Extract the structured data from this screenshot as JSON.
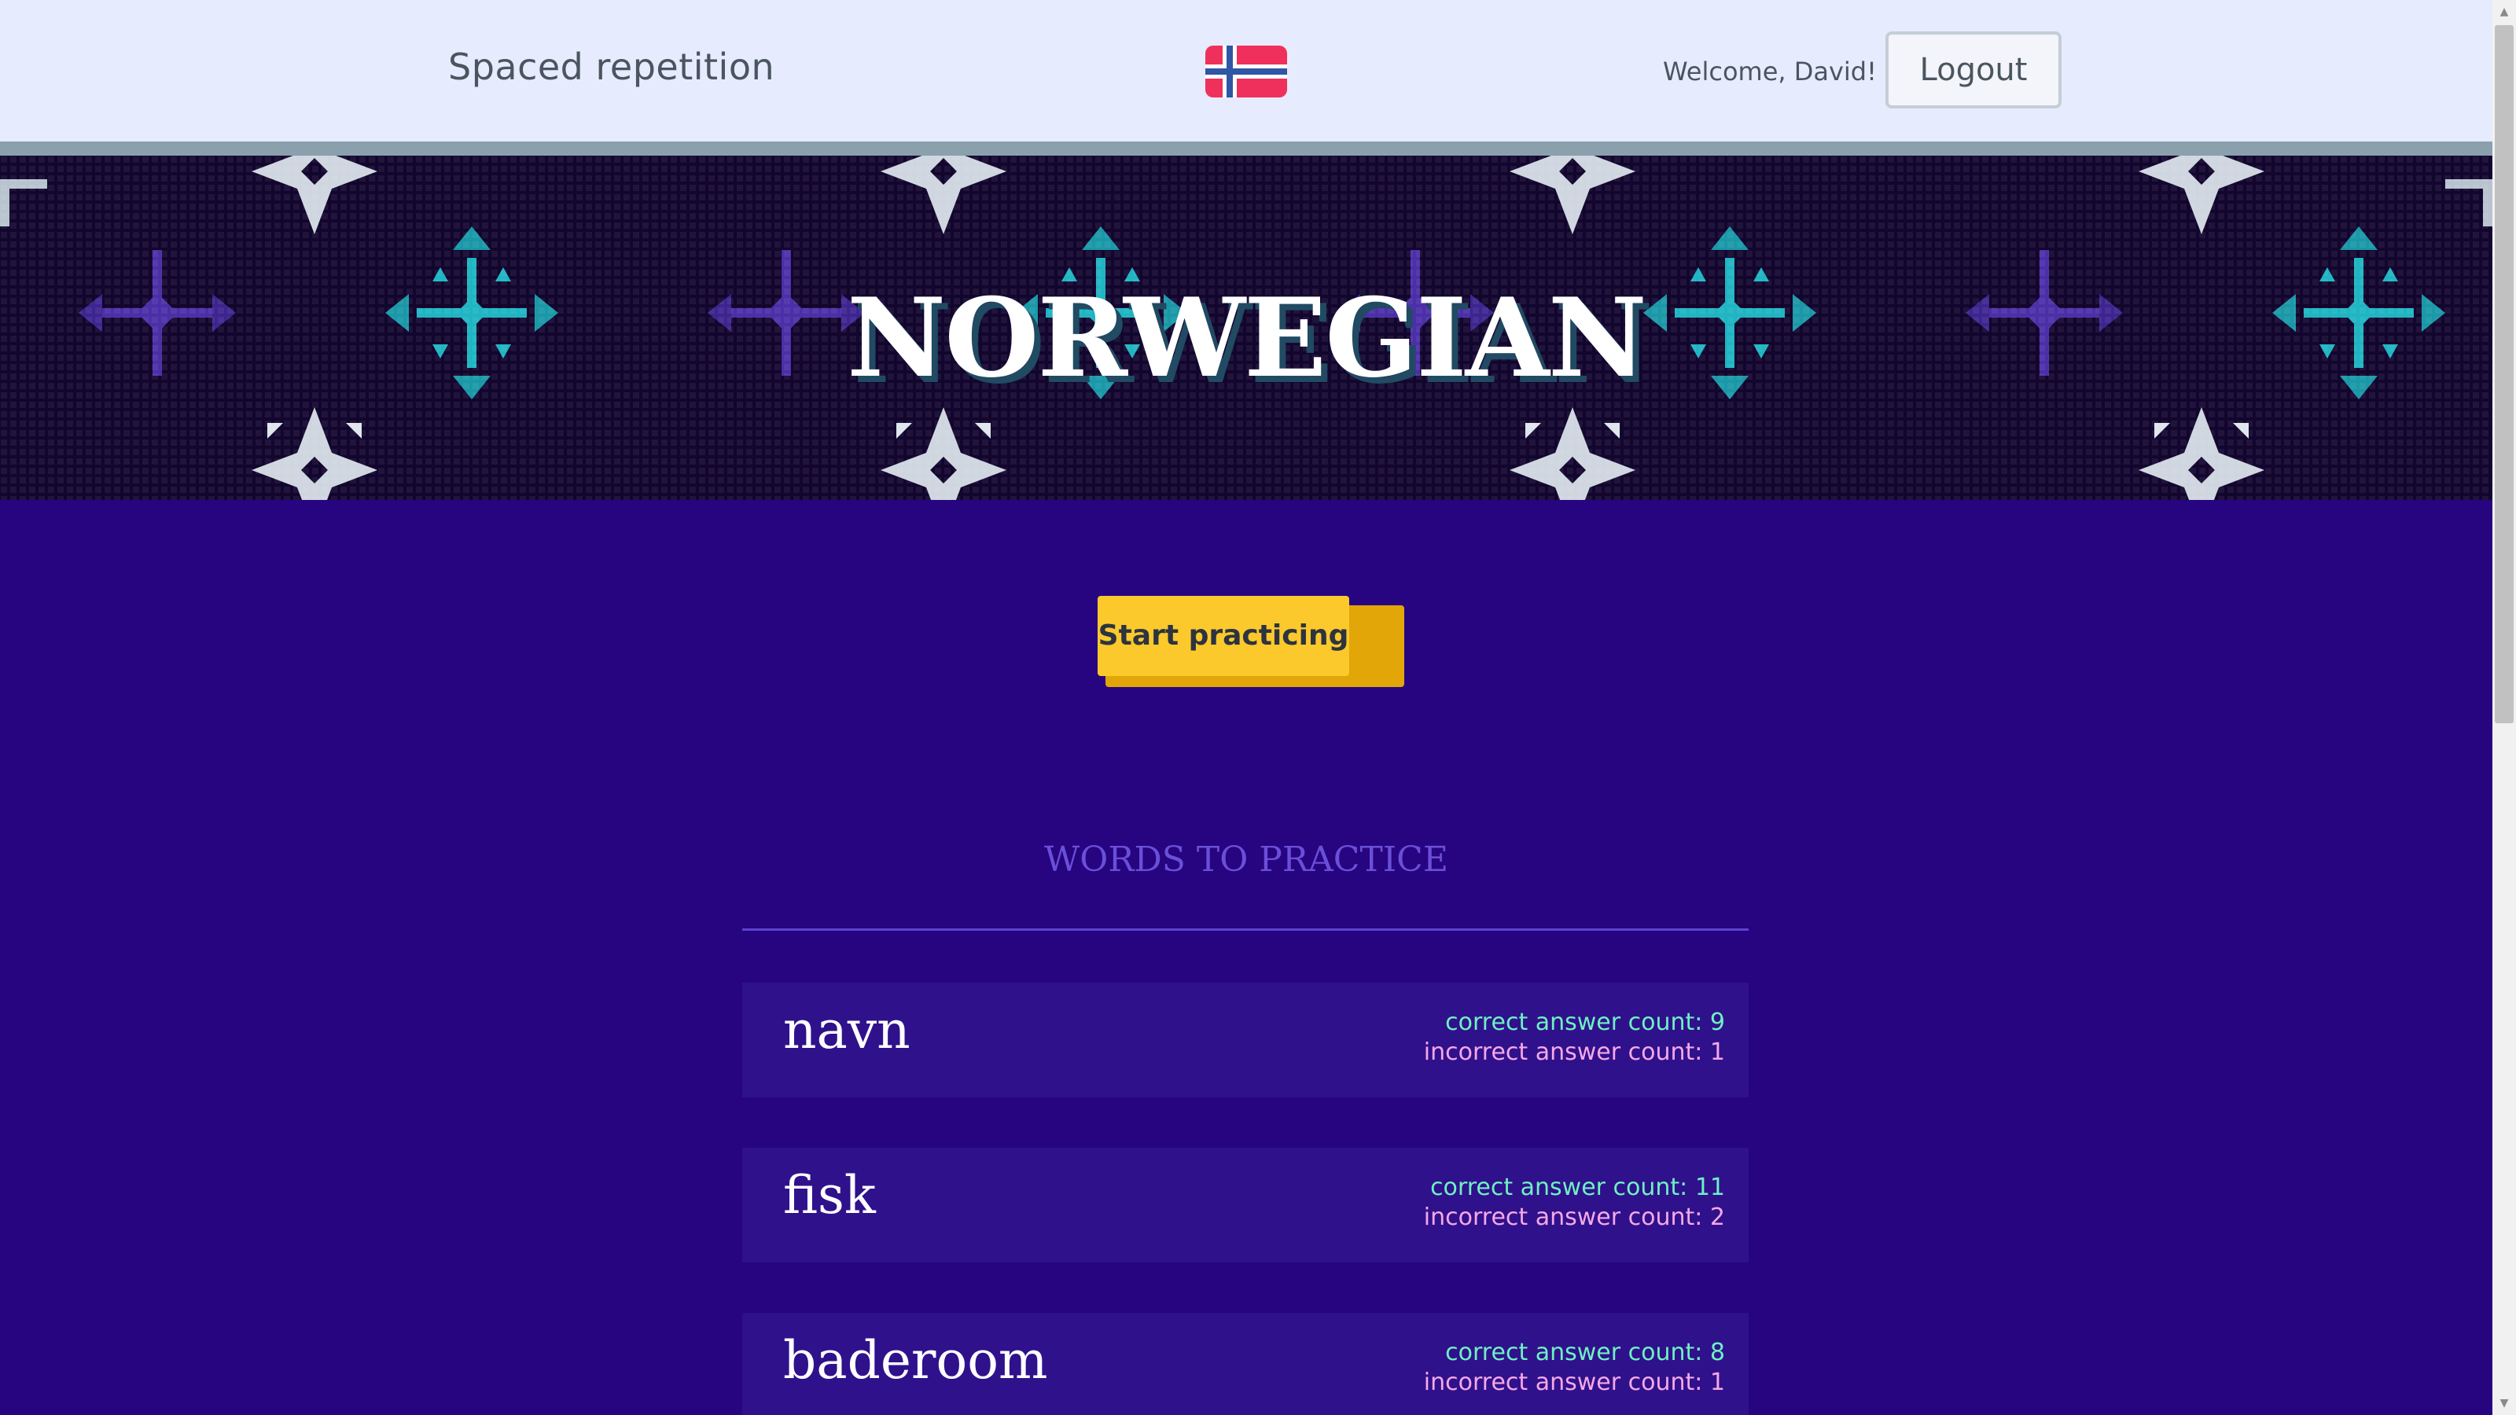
{
  "header": {
    "brand": "Spaced repetition",
    "flag_icon": "norway-flag-icon",
    "welcome": "Welcome, David!",
    "logout_label": "Logout"
  },
  "banner": {
    "title": "NORWEGIAN"
  },
  "main": {
    "start_label": "Start practicing",
    "section_title": "WORDS TO PRACTICE",
    "words": [
      {
        "word": "navn",
        "correct": "correct answer count: 9",
        "incorrect": "incorrect answer count: 1"
      },
      {
        "word": "fisk",
        "correct": "correct answer count: 11",
        "incorrect": "incorrect answer count: 2"
      },
      {
        "word": "baderoom",
        "correct": "correct answer count: 8",
        "incorrect": "incorrect answer count: 1"
      }
    ]
  },
  "colors": {
    "page_bg": "#270480",
    "header_bg": "#e6ecfd",
    "banner_bg": "#12052e",
    "accent_button": "#fbc92c",
    "correct_text": "#6ff0c2",
    "incorrect_text": "#f6a8e7"
  }
}
